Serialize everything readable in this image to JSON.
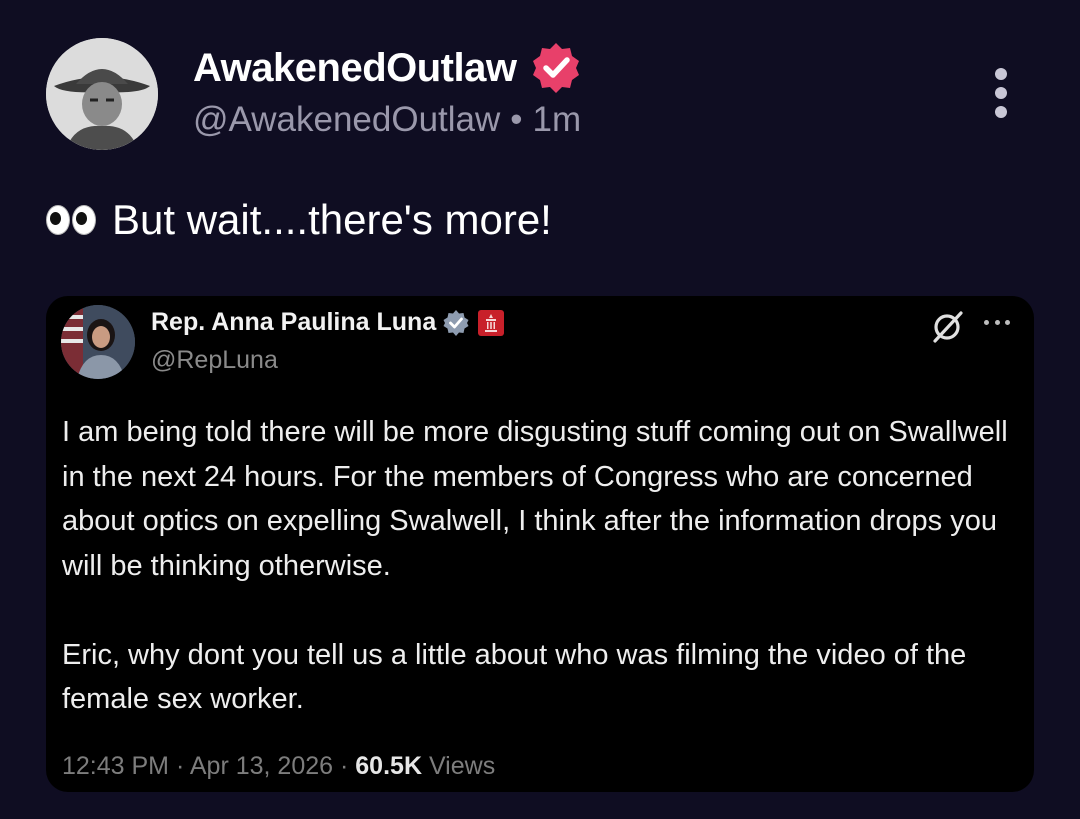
{
  "post": {
    "display_name": "AwakenedOutlaw",
    "handle": "@AwakenedOutlaw",
    "separator": "•",
    "time_ago": "1m",
    "text": "But wait....there's more!",
    "badge_color": "#e8406a"
  },
  "quoted": {
    "display_name": "Rep. Anna Paulina Luna",
    "handle": "@RepLuna",
    "paragraphs": [
      "I am being told there will be more disgusting stuff coming out on Swallwell in the next 24 hours. For the members of Congress who are concerned about optics on expelling Swalwell, I think after the information drops you will be thinking otherwise.",
      "Eric, why dont you tell us a little about who was filming the video of the female sex worker."
    ],
    "time": "12:43 PM",
    "date": "Apr 13, 2026",
    "meta_separator": "·",
    "views_count": "60.5K",
    "views_label": "Views",
    "verified_color": "#8e9cb0",
    "affiliation_badge_color": "#c8202a"
  },
  "icons": {
    "badge": "verified-icon",
    "menu": "more-vertical-icon",
    "eyes": "eyes-icon",
    "grok": "grok-icon",
    "quoted_menu": "more-horizontal-icon"
  }
}
